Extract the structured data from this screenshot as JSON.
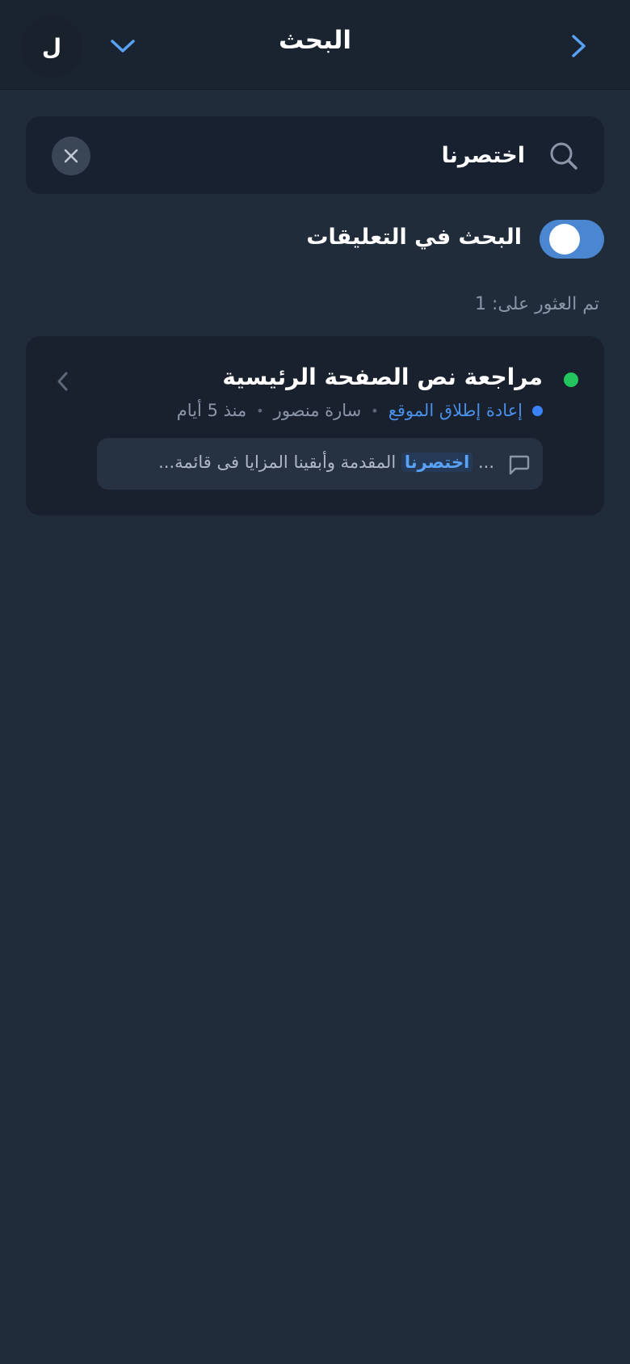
{
  "header": {
    "title": "البحث",
    "avatar_initial": "ل",
    "back_icon": "chevron-right-icon",
    "menu_icon": "chevron-down-icon"
  },
  "search": {
    "value": "اختصرنا",
    "placeholder": "",
    "icon": "search-icon",
    "clear_icon": "close-icon"
  },
  "toggle": {
    "label": "البحث في التعليقات",
    "on": true
  },
  "results": {
    "count_label": "تم العثور على: 1",
    "items": [
      {
        "title": "مراجعة نص الصفحة الرئيسية",
        "status_color": "#22c55e",
        "project": "إعادة إطلاق الموقع",
        "project_color": "#3b82f6",
        "author": "سارة منصور",
        "time": "منذ 5 أيام",
        "snippet_prefix": "...",
        "snippet_match": "اختصرنا",
        "snippet_suffix": "المقدمة وأبقينا المزايا فى قائمة..."
      }
    ]
  },
  "colors": {
    "background": "#212c3b",
    "accent": "#4b87d1",
    "highlight": "#5aa2f5"
  }
}
